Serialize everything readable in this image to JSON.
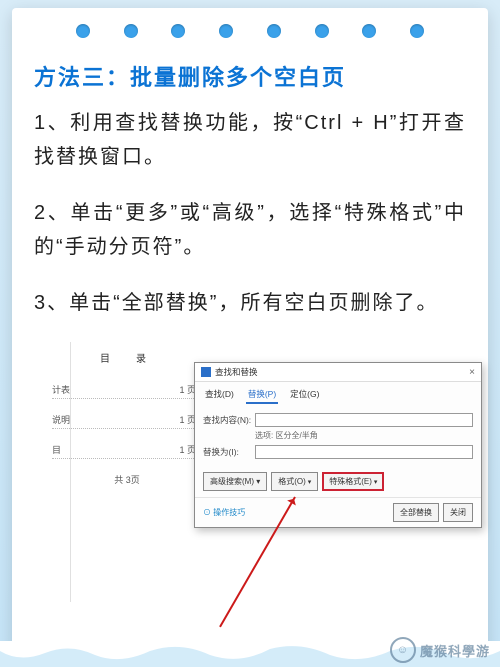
{
  "title": "方法三：批量删除多个空白页",
  "paragraphs": [
    "1、利用查找替换功能，按“Ctrl + H”打开查找替换窗口。",
    "2、单击“更多”或“高级”，选择“特殊格式”中的“手动分页符”。",
    "3、单击“全部替换”，所有空白页删除了。"
  ],
  "doc": {
    "toc_title": "目　录",
    "rows": [
      {
        "k": "计表",
        "v": "1 页"
      },
      {
        "k": "说明",
        "v": "1 页"
      },
      {
        "k": "目",
        "v": "1 页"
      }
    ],
    "total": "共 3页"
  },
  "dialog": {
    "title": "查找和替换",
    "tabs": [
      "查找(D)",
      "替换(P)",
      "定位(G)"
    ],
    "find_label": "查找内容(N):",
    "options_label": "选项:",
    "options_value": "区分全/半角",
    "replace_label": "替换为(I):",
    "btn_more": "高级搜索(M) ▾",
    "btn_format": "格式(O)",
    "btn_special": "特殊格式(E)",
    "tips": "⊙ 操作技巧",
    "btn_replace_all": "全部替换",
    "btn_close": "关闭"
  },
  "brand": "魔猴科學游"
}
